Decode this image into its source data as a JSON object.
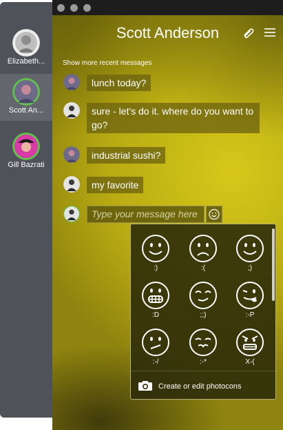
{
  "sidebar": {
    "contacts": [
      {
        "name": "Elizabeth...",
        "selected": false
      },
      {
        "name": "Scott An...",
        "selected": true
      },
      {
        "name": "Gill Bazrati",
        "selected": false
      }
    ]
  },
  "chat": {
    "title": "Scott Anderson",
    "show_more": "Show more recent messages",
    "messages": [
      {
        "text": "lunch today?",
        "sender": "other"
      },
      {
        "text": "sure - let's do it. where do you want to go?",
        "sender": "me"
      },
      {
        "text": "industrial sushi?",
        "sender": "other"
      },
      {
        "text": "my favorite",
        "sender": "me"
      }
    ],
    "composer": {
      "placeholder": "Type your message here"
    }
  },
  "emoticons": {
    "items": [
      {
        "code": ":)",
        "icon": "smile-icon"
      },
      {
        "code": ":(",
        "icon": "frown-icon"
      },
      {
        "code": ";)",
        "icon": "wink-icon"
      },
      {
        "code": ":D",
        "icon": "grin-icon"
      },
      {
        "code": ";;)",
        "icon": "flirt-icon"
      },
      {
        "code": ":-P",
        "icon": "tongue-icon"
      },
      {
        "code": ":-/",
        "icon": "skeptical-icon"
      },
      {
        "code": ":-*",
        "icon": "kiss-icon"
      },
      {
        "code": "X-(",
        "icon": "angry-icon"
      }
    ],
    "photocon_label": "Create or edit photocons"
  },
  "colors": {
    "accent_ring": "#62c04e",
    "sidebar": "#4f5258",
    "chat_background": "#c9bb15"
  }
}
